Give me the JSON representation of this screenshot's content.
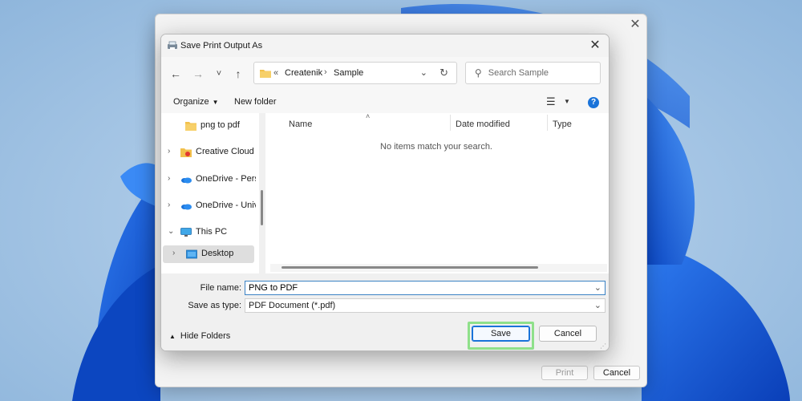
{
  "dialog": {
    "title": "Save Print Output As",
    "close_glyph": "✕"
  },
  "background_window": {
    "close_glyph": "✕",
    "print_label": "Print",
    "cancel_label": "Cancel"
  },
  "navigation": {
    "back_glyph": "←",
    "forward_glyph": "→",
    "recent_glyph": "˅",
    "up_glyph": "↑",
    "address": {
      "prefix": "«",
      "crumbs": [
        "Createnik",
        "Sample"
      ],
      "separator": "›",
      "dropdown_glyph": "⌄",
      "refresh_glyph": "↻"
    },
    "search": {
      "placeholder": "Search Sample",
      "value": ""
    }
  },
  "toolbar": {
    "organize_label": "Organize",
    "new_folder_label": "New folder",
    "caret": "▼",
    "view_glyph": "☰",
    "help_glyph": "?"
  },
  "sidebar": {
    "items": [
      {
        "label": "png to pdf",
        "icon": "folder-icon",
        "expander": ""
      },
      {
        "label": "Creative Cloud F",
        "icon": "creative-cloud-icon",
        "expander": "›"
      },
      {
        "label": "OneDrive - Perso",
        "icon": "onedrive-icon",
        "expander": "›"
      },
      {
        "label": "OneDrive - Unive",
        "icon": "onedrive-icon",
        "expander": "›"
      },
      {
        "label": "This PC",
        "icon": "computer-icon",
        "expander": "⌄"
      },
      {
        "label": "Desktop",
        "icon": "desktop-icon",
        "expander": "›",
        "selected": true
      }
    ]
  },
  "file_list": {
    "columns": [
      "Name",
      "Date modified",
      "Type"
    ],
    "sort_arrow": "˄",
    "empty_message": "No items match your search."
  },
  "form": {
    "file_name_label": "File name:",
    "file_name_value": "PNG to PDF",
    "save_type_label": "Save as type:",
    "save_type_value": "PDF Document (*.pdf)",
    "dropdown_glyph": "⌄"
  },
  "footer": {
    "hide_folders_label": "Hide Folders",
    "hide_caret": "▲",
    "save_label": "Save",
    "cancel_label": "Cancel"
  },
  "colors": {
    "accent": "#1a73d9",
    "highlight": "#8fe08a",
    "folder": "#f2c04b"
  }
}
